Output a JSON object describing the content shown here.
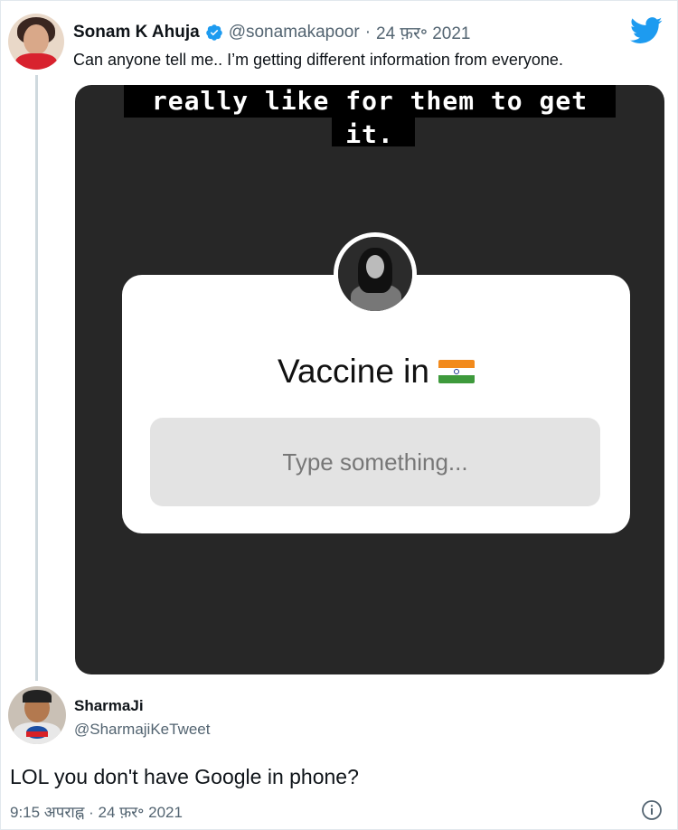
{
  "tweet": {
    "display_name": "Sonam K Ahuja",
    "handle": "@sonamakapoor",
    "separator": "·",
    "date": "24 फ़र॰ 2021",
    "text": "Can anyone tell me.. I’m getting different information from everyone.",
    "verified_icon": "verified-badge-icon",
    "brand_icon": "twitter-bird-icon"
  },
  "media": {
    "caption_line1": "really like for them to get",
    "caption_line2": "it.",
    "question_title": "Vaccine in",
    "flag": "india-flag-icon",
    "answer_placeholder": "Type something..."
  },
  "reply": {
    "display_name": "SharmaJi",
    "handle": "@SharmajiKeTweet",
    "text": "LOL you don't have Google in phone?",
    "meta": "9:15 अपराह्न · 24 फ़र॰ 2021",
    "info_icon": "info-icon"
  },
  "colors": {
    "twitter_blue": "#1d9bf0",
    "secondary_text": "#536471",
    "media_bg": "#272727"
  }
}
